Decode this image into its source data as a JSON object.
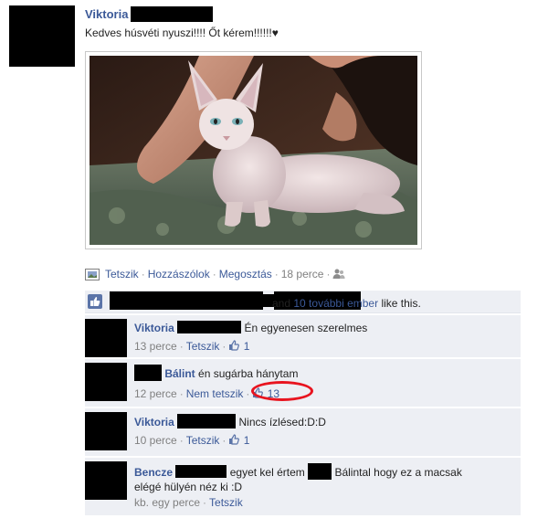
{
  "post": {
    "poster_name": "Viktoria",
    "status_text": "Kedves húsvéti nyuszi!!!! Őt kérem!!!!!!♥",
    "actions": {
      "like": "Tetszik",
      "comment": "Hozzászólok",
      "share": "Megosztás",
      "time": "18 perce"
    },
    "likes_summary": {
      "and": "and",
      "others_link": "10 további ember",
      "suffix": "like this."
    }
  },
  "comments": [
    {
      "author": "Viktoria",
      "text": "Én egyenesen szerelmes",
      "time": "13 perce",
      "like_action": "Tetszik",
      "like_count": "1"
    },
    {
      "author": "Bálint",
      "text": "én sugárba hánytam",
      "time": "12 perce",
      "like_action": "Nem tetszik",
      "like_count": "13"
    },
    {
      "author": "Viktoria",
      "text": "Nincs ízlésed:D:D",
      "time": "10 perce",
      "like_action": "Tetszik",
      "like_count": "1"
    },
    {
      "author": "Bencze",
      "text_a": "egyet kel értem",
      "text_b": "Bálintal hogy ez a macsak",
      "text_c": "elégé hülyén néz ki :D",
      "time": "kb. egy perce",
      "like_action": "Tetszik"
    }
  ],
  "colors": {
    "link": "#3b5998",
    "comment_bg": "#edeff4",
    "highlight_circle": "#e8141f"
  }
}
